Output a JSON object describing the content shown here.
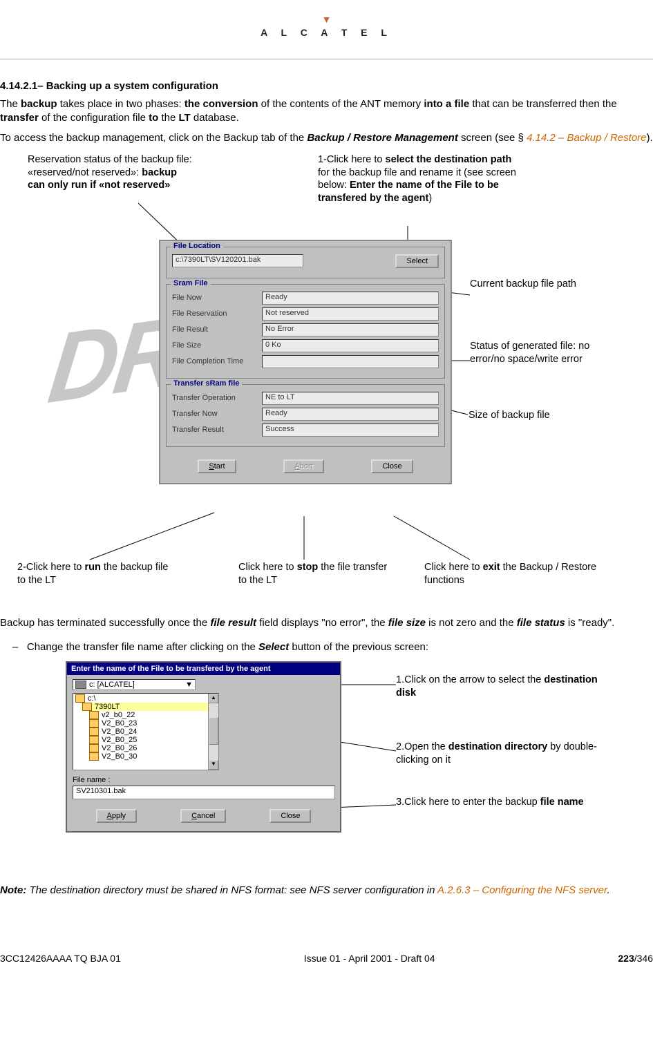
{
  "logo": {
    "brand": "A L C A T E L"
  },
  "section": {
    "number": "4.14.2.1–",
    "title": "Backing up a system configuration"
  },
  "para1": {
    "t1": "The ",
    "b1": "backup",
    "t2": " takes place in two phases: ",
    "b2": "the conversion",
    "t3": " of the contents of the ANT memory ",
    "b3": "into a file",
    "t4": " that can be transferred then the ",
    "b4": "transfer",
    "t5": " of the configuration file ",
    "b5": "to",
    "t6": " the ",
    "b6": "LT",
    "t7": " database."
  },
  "para2": {
    "t1": "To access the backup management, click on the Backup tab of the ",
    "bi1": "Backup  / Restore Management",
    "t2": " screen (see § ",
    "link": "4.14.2 – Backup / Restore",
    "t3": ")."
  },
  "callouts": {
    "leftTop": {
      "l1": "Reservation status of the backup file:",
      "l2": "«reserved/not reserved»: ",
      "b2": "backup",
      "l3b": "can only run if «not reserved»"
    },
    "rightTop": {
      "l1a": "1-Click here to ",
      "l1b": "select the destination path",
      "l2": "for the backup file and rename it (see screen",
      "l3a": "below: ",
      "l3b": "Enter the name of the File to be",
      "l4b": "transfered by the agent",
      "l4c": ")"
    },
    "curPath": "Current backup file path",
    "status": "Status of generated file: no error/no space/write error",
    "size": "Size of backup file",
    "start": {
      "a": "2-Click here to ",
      "b": "run",
      "c": " the backup file to the LT"
    },
    "abort": {
      "a": "Click here to ",
      "b": "stop",
      "c": " the file transfer to the LT"
    },
    "close": {
      "a": "Click here to ",
      "b": "exit",
      "c": " the Backup / Restore functions"
    }
  },
  "win1": {
    "group1": "File Location",
    "path": "c:\\7390LT\\SV120201.bak",
    "selectBtn": "Select",
    "group2": "Sram File",
    "fields2": [
      {
        "label": "File Now",
        "value": "Ready"
      },
      {
        "label": "File Reservation",
        "value": "Not reserved"
      },
      {
        "label": "File Result",
        "value": "No Error"
      },
      {
        "label": "File Size",
        "value": "0 Ko"
      },
      {
        "label": "File Completion Time",
        "value": ""
      }
    ],
    "group3": "Transfer sRam file",
    "fields3": [
      {
        "label": "Transfer Operation",
        "value": "NE to LT"
      },
      {
        "label": "Transfer Now",
        "value": "Ready"
      },
      {
        "label": "Transfer Result",
        "value": "Success"
      }
    ],
    "btnStart": "Start",
    "btnAbort": "Abort",
    "btnClose": "Close"
  },
  "para3": {
    "t1": "Backup has terminated successfully once the ",
    "bi1": "file result",
    "t2": " field displays \"no error\", the ",
    "bi2": "file size",
    "t3": " is not zero and the ",
    "bi3": "file status",
    "t4": " is \"ready\"."
  },
  "bullet": {
    "dash": "–",
    "t1": "Change the transfer file name after clicking on the ",
    "bi1": "Select",
    "t2": " button of the previous screen:"
  },
  "win2": {
    "title": "Enter the name of the File to be transfered by the agent",
    "drive": "c: [ALCATEL]",
    "folders": [
      "c:\\",
      "7390LT",
      "v2_b0_22",
      "V2_B0_23",
      "V2_B0_24",
      "V2_B0_25",
      "V2_B0_26",
      "V2_B0_30"
    ],
    "fileNameLabel": "File name :",
    "fileNameValue": "SV210301.bak",
    "btnApply": "Apply",
    "btnCancel": "Cancel",
    "btnClose": "Close"
  },
  "callouts2": {
    "disk": {
      "a": "1.Click on the arrow to select the ",
      "b": "destination disk"
    },
    "dir": {
      "a": "2.Open the ",
      "b": "destination directory",
      "c": " by double-clicking on it"
    },
    "file": {
      "a": "3.Click here to enter the backup ",
      "b": "file name"
    }
  },
  "note": {
    "label": "Note:",
    "t1": "  The destination directory must be shared in NFS format: see NFS server configuration in ",
    "link": "A.2.6.3 – Configuring the NFS server",
    "t2": "."
  },
  "footer": {
    "left": "3CC12426AAAA TQ BJA 01",
    "center": "Issue 01 - April 2001 - Draft 04",
    "rightBold": "223",
    "rightRest": "/346"
  }
}
